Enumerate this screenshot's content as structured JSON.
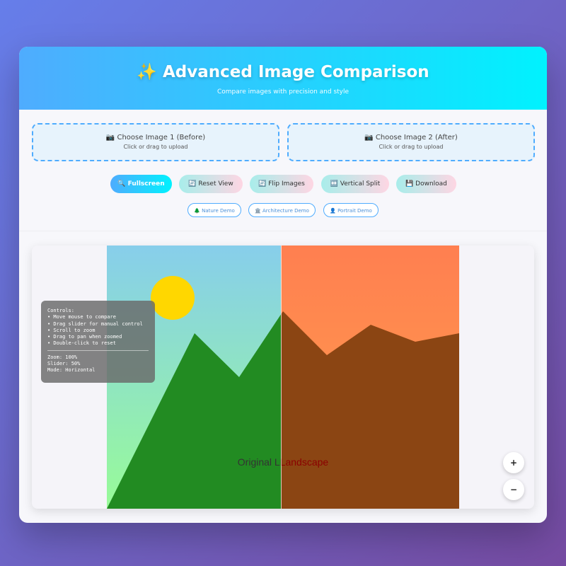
{
  "header": {
    "title": "✨ Advanced Image Comparison",
    "subtitle": "Compare images with precision and style"
  },
  "uploads": [
    {
      "title": "📷 Choose Image 1 (Before)",
      "hint": "Click or drag to upload"
    },
    {
      "title": "📷 Choose Image 2 (After)",
      "hint": "Click or drag to upload"
    }
  ],
  "toolbar": {
    "fullscreen": "🔍 Fullscreen",
    "reset": "🔄 Reset View",
    "flip": "🔄 Flip Images",
    "vertical": "↔️ Vertical Split",
    "download": "💾 Download"
  },
  "demos": {
    "nature": "🌲 Nature Demo",
    "architecture": "🏛️ Architecture Demo",
    "portrait": "👤 Portrait Demo"
  },
  "viewer": {
    "label_before": "Original L",
    "label_after": "Landscape"
  },
  "controls": {
    "heading": "Controls:",
    "items": [
      "• Move mouse to compare",
      "• Drag slider for manual control",
      "• Scroll to zoom",
      "• Drag to pan when zoomed",
      "• Double-click to reset"
    ],
    "zoom": "Zoom: 100%",
    "slider": "Slider: 50%",
    "mode": "Mode: Horizontal"
  },
  "zoom_controls": {
    "zoom_in": "+",
    "zoom_out": "−"
  },
  "colors": {
    "header_gradient_start": "#4facfe",
    "header_gradient_end": "#00f2fe",
    "background_start": "#667eea",
    "background_end": "#764ba2"
  }
}
